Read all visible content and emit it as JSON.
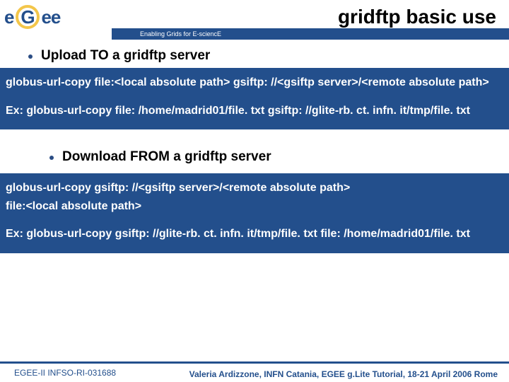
{
  "header": {
    "logo_text_a": "e",
    "logo_text_b": "ee",
    "tagline": "Enabling Grids for E-sciencE",
    "title": "gridftp basic use"
  },
  "bullets": {
    "upload": "Upload TO a gridftp server",
    "download": "Download FROM a gridftp server"
  },
  "code_upload": {
    "line1": "globus-url-copy  file:<local absolute path> gsiftp: //<gsiftp server>/<remote absolute path>",
    "ex1": "Ex: globus-url-copy  file: /home/madrid01/file. txt  gsiftp: //glite-rb. ct. infn. it/tmp/file. txt"
  },
  "code_download": {
    "line1": "globus-url-copy  gsiftp: //<gsiftp server>/<remote absolute path>",
    "line2": " file:<local absolute path>",
    "ex1": "Ex:  globus-url-copy gsiftp: //glite-rb. ct. infn. it/tmp/file. txt file: /home/madrid01/file. txt"
  },
  "footer": {
    "left": "EGEE-II INFSO-RI-031688",
    "right": "Valeria Ardizzone, INFN Catania, EGEE g.Lite Tutorial, 18-21 April 2006 Rome"
  }
}
